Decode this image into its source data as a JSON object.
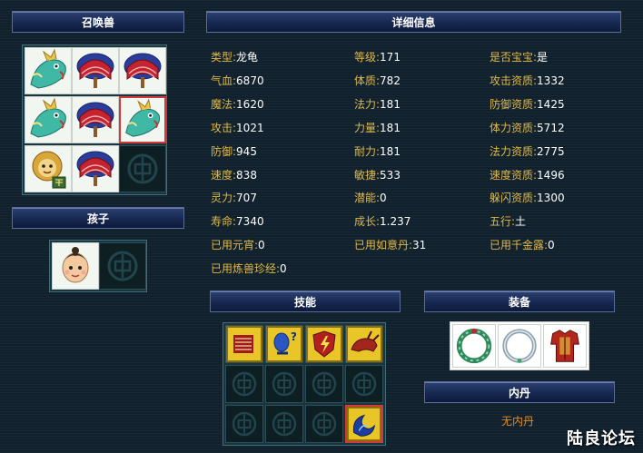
{
  "headers": {
    "summon": "召唤兽",
    "detail": "详细信息",
    "child": "孩子",
    "skills": "技能",
    "equipment": "装备",
    "neidan": "内丹"
  },
  "summon_grid": [
    {
      "icon": "dragon-turtle-icon"
    },
    {
      "icon": "red-fan-icon"
    },
    {
      "icon": "red-fan-icon"
    },
    {
      "icon": "dragon-turtle-icon"
    },
    {
      "icon": "red-fan-icon"
    },
    {
      "icon": "dragon-turtle-icon",
      "selected": true
    },
    {
      "icon": "golden-lion-icon"
    },
    {
      "icon": "red-fan-icon"
    },
    {
      "icon": "empty-slot-icon"
    }
  ],
  "child_grid": [
    {
      "icon": "child-face-icon"
    },
    {
      "icon": "empty-slot-icon"
    }
  ],
  "stats": {
    "col1": [
      {
        "label": "类型:",
        "value": "龙龟"
      },
      {
        "label": "气血:",
        "value": "6870"
      },
      {
        "label": "魔法:",
        "value": "1620"
      },
      {
        "label": "攻击:",
        "value": "1021"
      },
      {
        "label": "防御:",
        "value": "945"
      },
      {
        "label": "速度:",
        "value": "838"
      },
      {
        "label": "灵力:",
        "value": "707"
      },
      {
        "label": "寿命:",
        "value": "7340"
      },
      {
        "label": "已用元宵:",
        "value": "0"
      },
      {
        "label": "已用炼兽珍经:",
        "value": "0"
      }
    ],
    "col2": [
      {
        "label": "等级:",
        "value": "171"
      },
      {
        "label": "体质:",
        "value": "782"
      },
      {
        "label": "法力:",
        "value": "181"
      },
      {
        "label": "力量:",
        "value": "181"
      },
      {
        "label": "耐力:",
        "value": "181"
      },
      {
        "label": "敏捷:",
        "value": "533"
      },
      {
        "label": "潜能:",
        "value": "0"
      },
      {
        "label": "成长:",
        "value": "1.237"
      },
      {
        "label": "已用如意丹:",
        "value": "31"
      }
    ],
    "col3": [
      {
        "label": "是否宝宝:",
        "value": "是"
      },
      {
        "label": "攻击资质:",
        "value": "1332"
      },
      {
        "label": "防御资质:",
        "value": "1425"
      },
      {
        "label": "体力资质:",
        "value": "5712"
      },
      {
        "label": "法力资质:",
        "value": "2775"
      },
      {
        "label": "速度资质:",
        "value": "1496"
      },
      {
        "label": "躲闪资质:",
        "value": "1300"
      },
      {
        "label": "五行:",
        "value": "土"
      },
      {
        "label": "已用千金露:",
        "value": "0"
      }
    ]
  },
  "skills_grid": [
    {
      "icon": "skill-defense-icon"
    },
    {
      "icon": "skill-mystery-icon"
    },
    {
      "icon": "skill-shield-icon"
    },
    {
      "icon": "skill-bull-icon"
    },
    {
      "icon": "empty-slot-icon"
    },
    {
      "icon": "empty-slot-icon"
    },
    {
      "icon": "empty-slot-icon"
    },
    {
      "icon": "empty-slot-icon"
    },
    {
      "icon": "empty-slot-icon"
    },
    {
      "icon": "empty-slot-icon"
    },
    {
      "icon": "empty-slot-icon"
    },
    {
      "icon": "skill-water-wave-icon",
      "selected": true
    }
  ],
  "equipment_items": [
    {
      "icon": "jade-ring-icon"
    },
    {
      "icon": "silver-ring-icon"
    },
    {
      "icon": "red-armor-icon"
    }
  ],
  "neidan_text": "无内丹",
  "watermark": "陆良论坛",
  "colors": {
    "label": "#e0b84a",
    "value": "#ffffff",
    "accent_red": "#d23a3a",
    "neidan_orange": "#e28c2a"
  }
}
